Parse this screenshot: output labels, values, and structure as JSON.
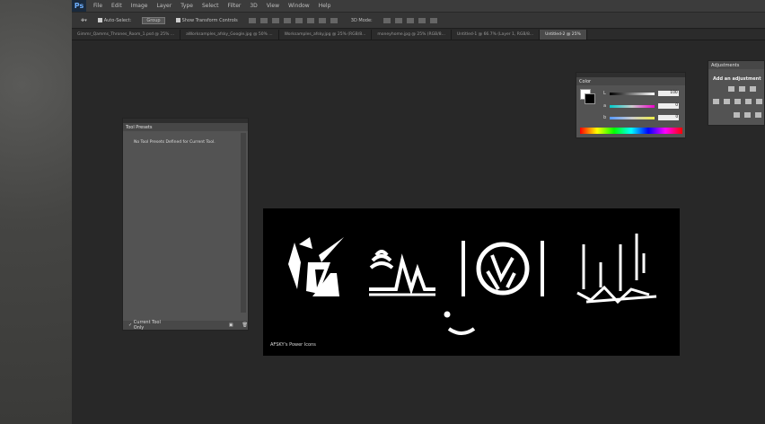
{
  "menubar": {
    "logo": "Ps",
    "items": [
      "File",
      "Edit",
      "Image",
      "Layer",
      "Type",
      "Select",
      "Filter",
      "3D",
      "View",
      "Window",
      "Help"
    ]
  },
  "options": {
    "auto_select": "Auto-Select:",
    "group": "Group",
    "show_transform": "Show Transform Controls",
    "mode_3d": "3D Mode:"
  },
  "tabs": [
    "Gimmr_Qamms_Thrones_Room_1.psd @ 25% ...",
    "aWorksamples_afsky_Google.jpg @ 50% ...",
    "Worksamples_afsky.jpg @ 25% (RGB/8...",
    "moneyhome.jpg @ 25% (RGB/8...",
    "Untitled-1 @ 66.7% (Layer 1, RGB/8...",
    "Untitled-2 @ 25%"
  ],
  "tool_presets": {
    "title": "Tool Presets",
    "message": "No Tool Presets Defined for Current Tool.",
    "footer": "Current Tool Only"
  },
  "color_panel": {
    "title": "Color",
    "channels": [
      {
        "label": "L",
        "value": "100"
      },
      {
        "label": "a",
        "value": "0"
      },
      {
        "label": "b",
        "value": "0"
      }
    ]
  },
  "adjustments": {
    "title": "Adjustments",
    "subtitle": "Add an adjustment"
  },
  "canvas": {
    "caption": "AFSKY's Power Icons"
  }
}
